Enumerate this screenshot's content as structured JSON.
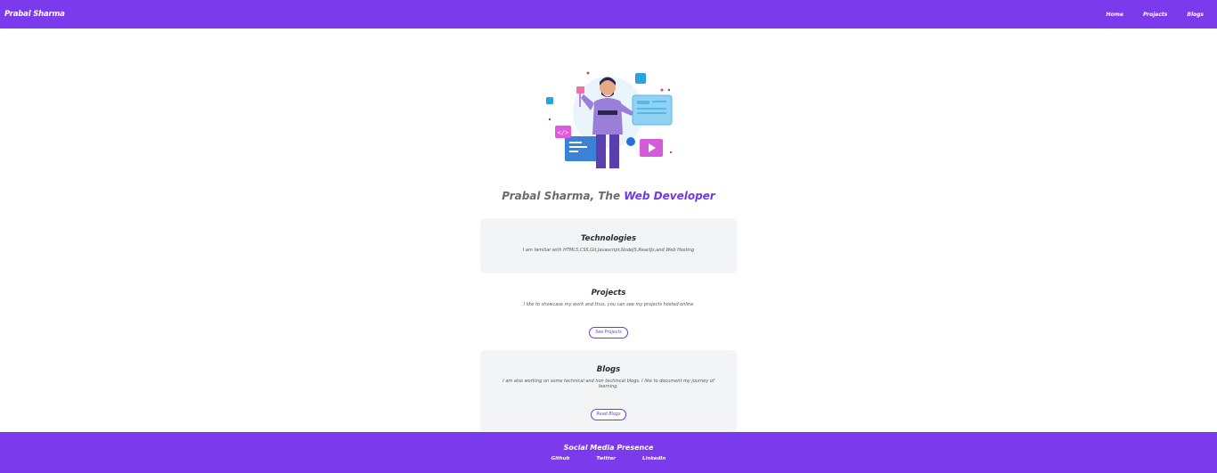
{
  "nav": {
    "brand": "Prabal Sharma",
    "links": [
      "Home",
      "Projects",
      "Blogs"
    ]
  },
  "hero": {
    "illustration": "developer-illustration"
  },
  "headline": {
    "prefix": "Prabal Sharma, The ",
    "accent": "Web Developer"
  },
  "sections": {
    "technologies": {
      "title": "Technologies",
      "text": "I am familiar with HTML5,CSS,Git,Javascript,NodeJS,ReactJs,and Web Hosting"
    },
    "projects": {
      "title": "Projects",
      "text": "I like to showcase my work and thus, you can see my projects hosted online",
      "button": "See Projects"
    },
    "blogs": {
      "title": "Blogs",
      "text": "I am also working on some technical and non techincal blogs. I like to document my journey of learning.",
      "button": "Read Blogs"
    }
  },
  "footer": {
    "title": "Social Media Presence",
    "links": [
      "Github",
      "Twitter",
      "LinkedIn"
    ]
  },
  "colors": {
    "primary": "#7c3aed",
    "accent": "#6d3ae6",
    "card": "#f3f4f6"
  }
}
